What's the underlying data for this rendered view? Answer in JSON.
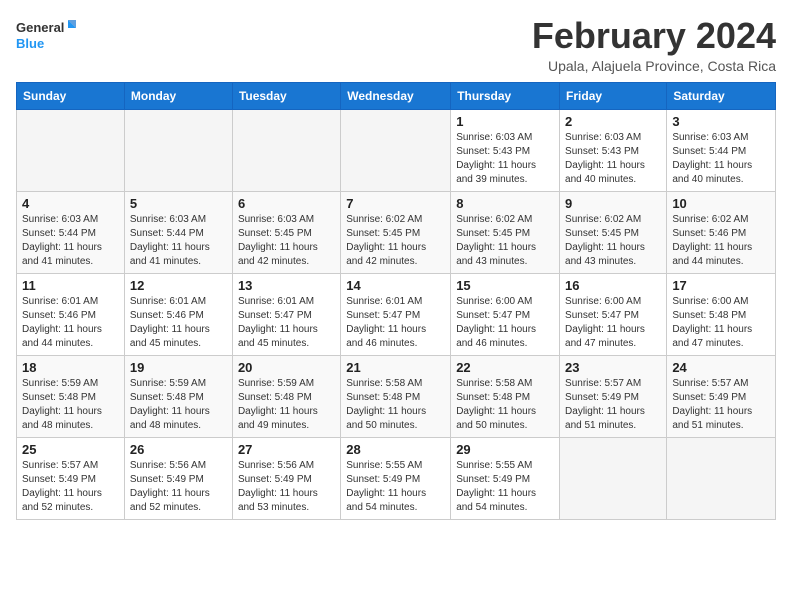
{
  "logo": {
    "line1": "General",
    "line2": "Blue"
  },
  "title": "February 2024",
  "subtitle": "Upala, Alajuela Province, Costa Rica",
  "weekdays": [
    "Sunday",
    "Monday",
    "Tuesday",
    "Wednesday",
    "Thursday",
    "Friday",
    "Saturday"
  ],
  "weeks": [
    [
      {
        "day": "",
        "info": ""
      },
      {
        "day": "",
        "info": ""
      },
      {
        "day": "",
        "info": ""
      },
      {
        "day": "",
        "info": ""
      },
      {
        "day": "1",
        "info": "Sunrise: 6:03 AM\nSunset: 5:43 PM\nDaylight: 11 hours\nand 39 minutes."
      },
      {
        "day": "2",
        "info": "Sunrise: 6:03 AM\nSunset: 5:43 PM\nDaylight: 11 hours\nand 40 minutes."
      },
      {
        "day": "3",
        "info": "Sunrise: 6:03 AM\nSunset: 5:44 PM\nDaylight: 11 hours\nand 40 minutes."
      }
    ],
    [
      {
        "day": "4",
        "info": "Sunrise: 6:03 AM\nSunset: 5:44 PM\nDaylight: 11 hours\nand 41 minutes."
      },
      {
        "day": "5",
        "info": "Sunrise: 6:03 AM\nSunset: 5:44 PM\nDaylight: 11 hours\nand 41 minutes."
      },
      {
        "day": "6",
        "info": "Sunrise: 6:03 AM\nSunset: 5:45 PM\nDaylight: 11 hours\nand 42 minutes."
      },
      {
        "day": "7",
        "info": "Sunrise: 6:02 AM\nSunset: 5:45 PM\nDaylight: 11 hours\nand 42 minutes."
      },
      {
        "day": "8",
        "info": "Sunrise: 6:02 AM\nSunset: 5:45 PM\nDaylight: 11 hours\nand 43 minutes."
      },
      {
        "day": "9",
        "info": "Sunrise: 6:02 AM\nSunset: 5:45 PM\nDaylight: 11 hours\nand 43 minutes."
      },
      {
        "day": "10",
        "info": "Sunrise: 6:02 AM\nSunset: 5:46 PM\nDaylight: 11 hours\nand 44 minutes."
      }
    ],
    [
      {
        "day": "11",
        "info": "Sunrise: 6:01 AM\nSunset: 5:46 PM\nDaylight: 11 hours\nand 44 minutes."
      },
      {
        "day": "12",
        "info": "Sunrise: 6:01 AM\nSunset: 5:46 PM\nDaylight: 11 hours\nand 45 minutes."
      },
      {
        "day": "13",
        "info": "Sunrise: 6:01 AM\nSunset: 5:47 PM\nDaylight: 11 hours\nand 45 minutes."
      },
      {
        "day": "14",
        "info": "Sunrise: 6:01 AM\nSunset: 5:47 PM\nDaylight: 11 hours\nand 46 minutes."
      },
      {
        "day": "15",
        "info": "Sunrise: 6:00 AM\nSunset: 5:47 PM\nDaylight: 11 hours\nand 46 minutes."
      },
      {
        "day": "16",
        "info": "Sunrise: 6:00 AM\nSunset: 5:47 PM\nDaylight: 11 hours\nand 47 minutes."
      },
      {
        "day": "17",
        "info": "Sunrise: 6:00 AM\nSunset: 5:48 PM\nDaylight: 11 hours\nand 47 minutes."
      }
    ],
    [
      {
        "day": "18",
        "info": "Sunrise: 5:59 AM\nSunset: 5:48 PM\nDaylight: 11 hours\nand 48 minutes."
      },
      {
        "day": "19",
        "info": "Sunrise: 5:59 AM\nSunset: 5:48 PM\nDaylight: 11 hours\nand 48 minutes."
      },
      {
        "day": "20",
        "info": "Sunrise: 5:59 AM\nSunset: 5:48 PM\nDaylight: 11 hours\nand 49 minutes."
      },
      {
        "day": "21",
        "info": "Sunrise: 5:58 AM\nSunset: 5:48 PM\nDaylight: 11 hours\nand 50 minutes."
      },
      {
        "day": "22",
        "info": "Sunrise: 5:58 AM\nSunset: 5:48 PM\nDaylight: 11 hours\nand 50 minutes."
      },
      {
        "day": "23",
        "info": "Sunrise: 5:57 AM\nSunset: 5:49 PM\nDaylight: 11 hours\nand 51 minutes."
      },
      {
        "day": "24",
        "info": "Sunrise: 5:57 AM\nSunset: 5:49 PM\nDaylight: 11 hours\nand 51 minutes."
      }
    ],
    [
      {
        "day": "25",
        "info": "Sunrise: 5:57 AM\nSunset: 5:49 PM\nDaylight: 11 hours\nand 52 minutes."
      },
      {
        "day": "26",
        "info": "Sunrise: 5:56 AM\nSunset: 5:49 PM\nDaylight: 11 hours\nand 52 minutes."
      },
      {
        "day": "27",
        "info": "Sunrise: 5:56 AM\nSunset: 5:49 PM\nDaylight: 11 hours\nand 53 minutes."
      },
      {
        "day": "28",
        "info": "Sunrise: 5:55 AM\nSunset: 5:49 PM\nDaylight: 11 hours\nand 54 minutes."
      },
      {
        "day": "29",
        "info": "Sunrise: 5:55 AM\nSunset: 5:49 PM\nDaylight: 11 hours\nand 54 minutes."
      },
      {
        "day": "",
        "info": ""
      },
      {
        "day": "",
        "info": ""
      }
    ]
  ]
}
